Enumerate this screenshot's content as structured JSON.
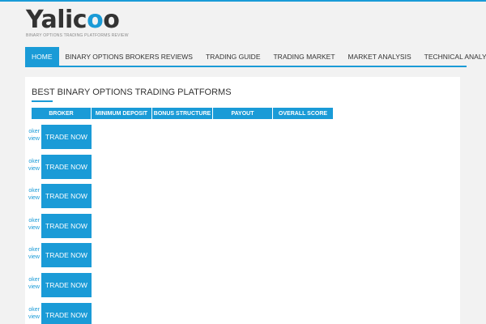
{
  "site": {
    "logo_main": "Yalic",
    "logo_o1": "o",
    "logo_o2": "o",
    "tagline": "BINARY OPTIONS TRADING PLATFORMS REVIEW"
  },
  "nav": {
    "items": [
      {
        "label": "HOME",
        "active": true
      },
      {
        "label": "BINARY OPTIONS BROKERS REVIEWS",
        "active": false
      },
      {
        "label": "TRADING GUIDE",
        "active": false
      },
      {
        "label": "TRADING MARKET",
        "active": false
      },
      {
        "label": "MARKET ANALYSIS",
        "active": false
      },
      {
        "label": "TECHNICAL ANALYSIS",
        "active": false
      }
    ],
    "search_icon": "search-icon"
  },
  "main": {
    "title": "BEST BINARY OPTIONS TRADING PLATFORMS",
    "columns": [
      "BROKER",
      "MINIMUM DEPOSIT",
      "BONUS STRUCTURE",
      "PAYOUT",
      "OVERALL SCORE"
    ],
    "rows": [
      {
        "review": "oker view",
        "button": "TRADE NOW"
      },
      {
        "review": "oker view",
        "button": "TRADE NOW"
      },
      {
        "review": "oker view",
        "button": "TRADE NOW"
      },
      {
        "review": "oker view",
        "button": "TRADE NOW"
      },
      {
        "review": "oker view",
        "button": "TRADE NOW"
      },
      {
        "review": "oker view",
        "button": "TRADE NOW"
      },
      {
        "review": "oker view",
        "button": "TRADE NOW"
      }
    ]
  },
  "colors": {
    "accent": "#1a9bd7",
    "background": "#f2f2f2",
    "content": "#ffffff"
  }
}
